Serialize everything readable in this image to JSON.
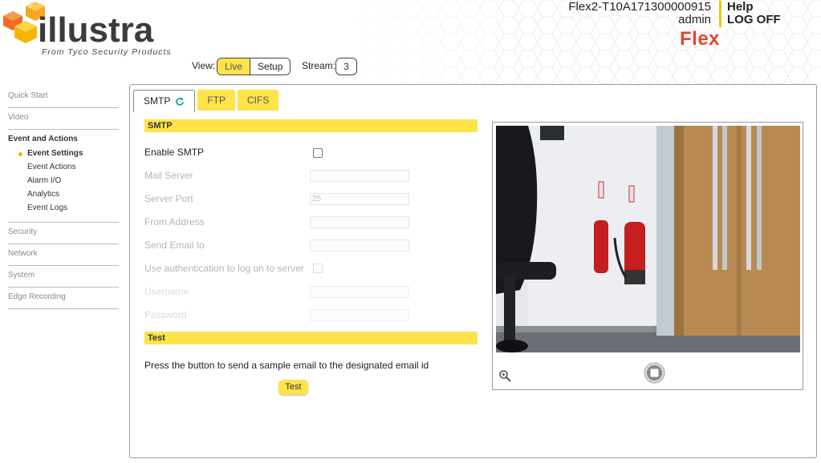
{
  "logo": {
    "brand": "illustra",
    "tagline": "From Tyco Security Products"
  },
  "header": {
    "device_name": "Flex2-T10A171300000915",
    "user": "admin",
    "help": "Help",
    "logoff": "LOG OFF",
    "product": "Flex"
  },
  "view": {
    "label": "View:",
    "live": "Live",
    "setup": "Setup",
    "stream_label": "Stream:",
    "stream_value": "3"
  },
  "sidebar": {
    "sections": [
      {
        "label": "Quick Start"
      },
      {
        "label": "Video"
      },
      {
        "label": "Event and Actions",
        "items": [
          "Event Settings",
          "Event Actions",
          "Alarm I/O",
          "Analytics",
          "Event Logs"
        ]
      },
      {
        "label": "Security"
      },
      {
        "label": "Network"
      },
      {
        "label": "System"
      },
      {
        "label": "Edge Recording"
      }
    ]
  },
  "tabs": [
    {
      "label": "SMTP"
    },
    {
      "label": "FTP"
    },
    {
      "label": "CIFS"
    }
  ],
  "smtp": {
    "section_title": "SMTP",
    "enable_label": "Enable SMTP",
    "mail_server_label": "Mail Server",
    "server_port_label": "Server Port",
    "server_port_value": "25",
    "from_address_label": "From Address",
    "send_email_label": "Send Email to",
    "auth_label": "Use authentication to log on to server",
    "username_label": "Username",
    "password_label": "Password"
  },
  "test": {
    "section_title": "Test",
    "description": "Press the button to send a sample email to the designated email id",
    "button": "Test"
  },
  "colors": {
    "accent_yellow": "#ffe34a",
    "brand_red": "#e8442c",
    "logo_orange": "#f5a623"
  }
}
